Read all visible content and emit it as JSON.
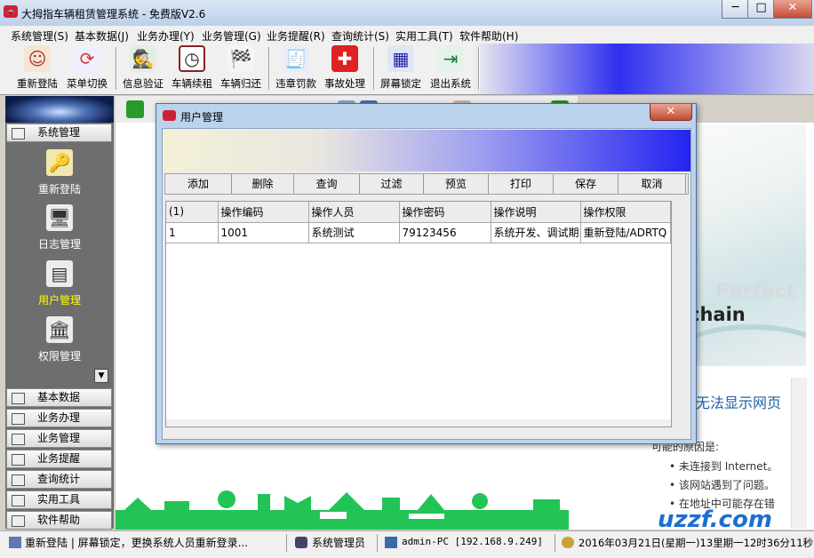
{
  "window": {
    "title": "大拇指车辆租赁管理系统 - 免费版V2.6",
    "app_icon": "car-icon",
    "controls": [
      "─",
      "□",
      "✕"
    ]
  },
  "menu": [
    "系统管理(S)",
    "基本数据(J)",
    "业务办理(Y)",
    "业务管理(G)",
    "业务提醒(R)",
    "查询统计(S)",
    "实用工具(T)",
    "软件帮助(H)"
  ],
  "toolbar": [
    {
      "label": "重新登陆",
      "icon": "users-icon"
    },
    {
      "label": "菜单切换",
      "icon": "refresh-icon"
    },
    {
      "label": "信息验证",
      "icon": "detective-icon"
    },
    {
      "label": "车辆续租",
      "icon": "clock-icon"
    },
    {
      "label": "车辆归还",
      "icon": "racecar-icon"
    },
    {
      "label": "违章罚款",
      "icon": "ticket-icon"
    },
    {
      "label": "事故处理",
      "icon": "first-aid-icon"
    },
    {
      "label": "屏幕锁定",
      "icon": "lock-screen-icon"
    },
    {
      "label": "退出系统",
      "icon": "exit-door-icon"
    }
  ],
  "left_panel": {
    "headers": [
      {
        "label": "系统管理",
        "icon": "book-icon"
      },
      {
        "label": "基本数据",
        "icon": "list-icon"
      },
      {
        "label": "业务办理",
        "icon": "list-icon"
      },
      {
        "label": "业务管理",
        "icon": "grid-icon"
      },
      {
        "label": "业务提醒",
        "icon": "grid-icon"
      },
      {
        "label": "查询统计",
        "icon": "table-icon"
      },
      {
        "label": "实用工具",
        "icon": "list-icon"
      },
      {
        "label": "软件帮助",
        "icon": "list-icon"
      }
    ],
    "items": [
      {
        "label": "重新登陆",
        "icon": "key-icon",
        "active": false
      },
      {
        "label": "日志管理",
        "icon": "monitor-icon",
        "active": false
      },
      {
        "label": "用户管理",
        "icon": "document-icon",
        "active": true
      },
      {
        "label": "权限管理",
        "icon": "bank-icon",
        "active": false
      }
    ],
    "active_color": "#ffff00"
  },
  "dialog": {
    "title": "用户管理",
    "close": "✕",
    "buttons": [
      "添加",
      "删除",
      "查询",
      "过滤",
      "预览",
      "打印",
      "保存",
      "取消"
    ],
    "table": {
      "columns": [
        "(1)",
        "操作编码",
        "操作人员",
        "操作密码",
        "操作说明",
        "操作权限"
      ],
      "rows": [
        [
          "1",
          "1001",
          "系统测试",
          "79123456",
          "系统开发、调试期",
          "重新登陆/ADRTQ"
        ]
      ]
    }
  },
  "webpage": {
    "error_title": "无法显示网页",
    "reasons_title": "可能的原因是:",
    "reasons": [
      "未连接到 Internet。",
      "该网站遇到了问题。",
      "在地址中可能存在错"
    ],
    "graphic_words": [
      "Perfect",
      "chain"
    ]
  },
  "statusbar": {
    "message": "重新登陆 | 屏幕锁定，更换系统人员重新登录...",
    "user": "系统管理员",
    "host": "admin-PC [192.168.9.249]",
    "datetime": "2016年03月21日(星期一)13里期一12时36分11秒"
  },
  "watermark": "uzzf.com",
  "colors": {
    "accent_blue": "#2424f0",
    "close_red": "#c54b33",
    "panel_gray": "#6e6e6e",
    "link_blue": "#1f5fa8"
  }
}
